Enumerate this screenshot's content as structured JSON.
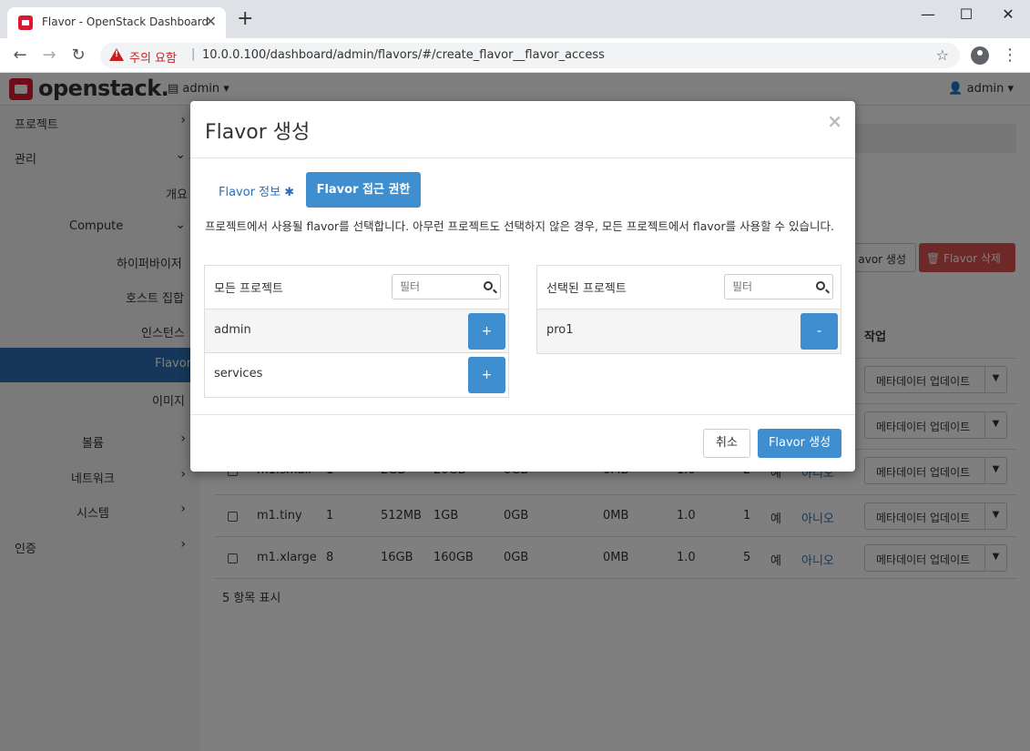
{
  "browser": {
    "tab_title": "Flavor - OpenStack Dashboard",
    "tab_close": "✕",
    "new_tab": "+",
    "minimize": "—",
    "maximize": "☐",
    "close": "✕",
    "back": "←",
    "forward": "→",
    "reload": "↻",
    "security_warning": "주의 요함",
    "separator": "|",
    "url": "10.0.0.100/dashboard/admin/flavors/#/create_flavor__flavor_access",
    "star": "☆",
    "menu": "⋮"
  },
  "topnav": {
    "logo": "openstack.",
    "project": "▤ admin ▾",
    "user": "👤 admin ▾"
  },
  "sidebar": {
    "items": [
      {
        "label": "프로젝트",
        "chev": "›"
      },
      {
        "label": "관리",
        "chev": "⌄"
      },
      {
        "label": "개요"
      },
      {
        "label": "Compute",
        "chev": "⌄"
      },
      {
        "label": "하이퍼바이저"
      },
      {
        "label": "호스트 집합"
      },
      {
        "label": "인스턴스"
      },
      {
        "label": "Flavor"
      },
      {
        "label": "이미지"
      },
      {
        "label": "볼륨",
        "chev": "›"
      },
      {
        "label": "네트워크",
        "chev": "›"
      },
      {
        "label": "시스템",
        "chev": "›"
      },
      {
        "label": "인증",
        "chev": "›"
      }
    ]
  },
  "content": {
    "create_flavor_btn": "avor 생성",
    "delete_flavor_btn": "🗑 Flavor 삭제",
    "actions_header": "작업",
    "meta_btn": "메타데이터 업데이트",
    "rows": [
      {
        "name": "m1.small",
        "vcpu": "1",
        "ram": "2GB",
        "disk": "20GB",
        "eph": "0GB",
        "swap": "0MB",
        "rxtx": "1.0",
        "id": "2",
        "public": "예",
        "meta": "아니오"
      },
      {
        "name": "m1.tiny",
        "vcpu": "1",
        "ram": "512MB",
        "disk": "1GB",
        "eph": "0GB",
        "swap": "0MB",
        "rxtx": "1.0",
        "id": "1",
        "public": "예",
        "meta": "아니오"
      },
      {
        "name": "m1.xlarge",
        "vcpu": "8",
        "ram": "16GB",
        "disk": "160GB",
        "eph": "0GB",
        "swap": "0MB",
        "rxtx": "1.0",
        "id": "5",
        "public": "예",
        "meta": "아니오"
      }
    ],
    "footer": "5 항목 표시"
  },
  "modal": {
    "title": "Flavor 생성",
    "close": "×",
    "tab_info": "Flavor 정보",
    "tab_info_required": "✱",
    "tab_access": "Flavor 접근 권한",
    "help": "프로젝트에서 사용될 flavor를 선택합니다. 아무런 프로젝트도 선택하지 않은 경우, 모든 프로젝트에서 flavor를 사용할 수 있습니다.",
    "all_projects": {
      "title": "모든 프로젝트",
      "filter_placeholder": "필터",
      "items": [
        {
          "name": "admin",
          "btn": "+"
        },
        {
          "name": "services",
          "btn": "+"
        }
      ]
    },
    "selected_projects": {
      "title": "선택된 프로젝트",
      "filter_placeholder": "필터",
      "items": [
        {
          "name": "pro1",
          "btn": "-"
        }
      ]
    },
    "cancel": "취소",
    "submit": "Flavor 생성"
  }
}
